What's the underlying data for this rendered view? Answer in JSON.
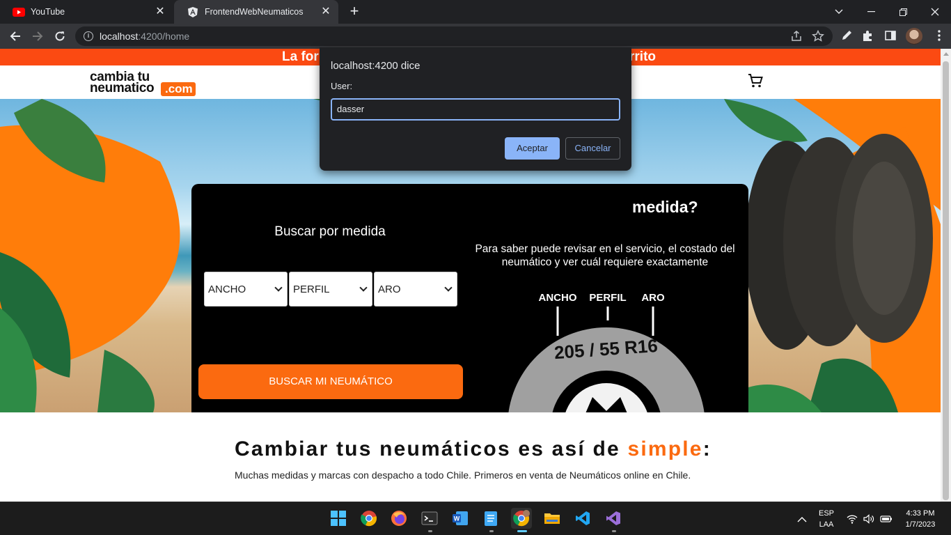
{
  "browser": {
    "tabs": [
      {
        "title": "YouTube",
        "icon": "youtube-icon"
      },
      {
        "title": "FrontendWebNeumaticos",
        "icon": "angular-icon",
        "active": true
      }
    ],
    "url": {
      "host": "localhost",
      "path": ":4200/home"
    }
  },
  "site": {
    "promo_left": "La form",
    "promo_right": "rrito",
    "logo_line1": "cambia tu",
    "logo_line2": "neumatico",
    "logo_com": ".com"
  },
  "search": {
    "title": "Buscar por medida",
    "selects": [
      {
        "value": "ANCHO"
      },
      {
        "value": "PERFIL"
      },
      {
        "value": "ARO"
      }
    ],
    "button": "BUSCAR MI NEUMÁTICO"
  },
  "measure": {
    "question": "medida?",
    "description": "Para saber puede revisar en el servicio, el costado del neumático y ver cuál requiere exactamente",
    "labels": [
      "ANCHO",
      "PERFIL",
      "ARO"
    ],
    "tire_code": "205 / 55 R16"
  },
  "content": {
    "headline_pre": "Cambiar tus neumáticos es así de ",
    "headline_accent": "simple",
    "headline_post": ":",
    "subline": "Muchas medidas y marcas con despacho a todo Chile. Primeros en venta de Neumáticos online en Chile."
  },
  "dialog": {
    "title": "localhost:4200 dice",
    "message": "User:",
    "input_value": "dasser",
    "ok": "Aceptar",
    "cancel": "Cancelar"
  },
  "taskbar": {
    "lang_top": "ESP",
    "lang_bottom": "LAA",
    "time": "4:33 PM",
    "date": "1/7/2023"
  },
  "colors": {
    "brand_orange": "#fb6a10",
    "promo_bar": "#fb4a12",
    "dialog_accent": "#8ab4f8"
  }
}
